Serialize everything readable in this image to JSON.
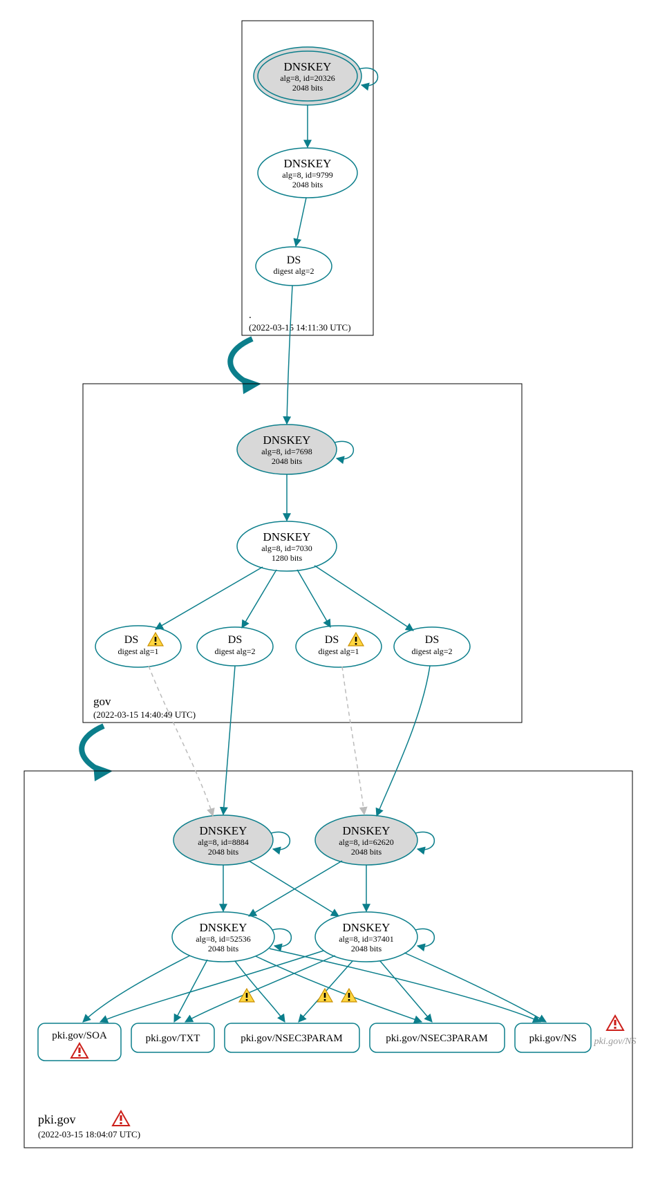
{
  "zones": {
    "root": {
      "name": ".",
      "timestamp": "(2022-03-15 14:11:30 UTC)"
    },
    "gov": {
      "name": "gov",
      "timestamp": "(2022-03-15 14:40:49 UTC)"
    },
    "pki": {
      "name": "pki.gov",
      "timestamp": "(2022-03-15 18:04:07 UTC)"
    }
  },
  "nodes": {
    "root_ksk": {
      "title": "DNSKEY",
      "l2": "alg=8, id=20326",
      "l3": "2048 bits"
    },
    "root_zsk": {
      "title": "DNSKEY",
      "l2": "alg=8, id=9799",
      "l3": "2048 bits"
    },
    "root_ds": {
      "title": "DS",
      "l2": "digest alg=2"
    },
    "gov_ksk": {
      "title": "DNSKEY",
      "l2": "alg=8, id=7698",
      "l3": "2048 bits"
    },
    "gov_zsk": {
      "title": "DNSKEY",
      "l2": "alg=8, id=7030",
      "l3": "1280 bits"
    },
    "gov_ds1": {
      "title": "DS",
      "l2": "digest alg=1"
    },
    "gov_ds2": {
      "title": "DS",
      "l2": "digest alg=2"
    },
    "gov_ds3": {
      "title": "DS",
      "l2": "digest alg=1"
    },
    "gov_ds4": {
      "title": "DS",
      "l2": "digest alg=2"
    },
    "pki_ksk1": {
      "title": "DNSKEY",
      "l2": "alg=8, id=8884",
      "l3": "2048 bits"
    },
    "pki_ksk2": {
      "title": "DNSKEY",
      "l2": "alg=8, id=62620",
      "l3": "2048 bits"
    },
    "pki_zsk1": {
      "title": "DNSKEY",
      "l2": "alg=8, id=52536",
      "l3": "2048 bits"
    },
    "pki_zsk2": {
      "title": "DNSKEY",
      "l2": "alg=8, id=37401",
      "l3": "2048 bits"
    },
    "rr_soa": {
      "label": "pki.gov/SOA"
    },
    "rr_txt": {
      "label": "pki.gov/TXT"
    },
    "rr_n3p1": {
      "label": "pki.gov/NSEC3PARAM"
    },
    "rr_n3p2": {
      "label": "pki.gov/NSEC3PARAM"
    },
    "rr_ns": {
      "label": "pki.gov/NS"
    },
    "rr_ns_ghost": {
      "label": "pki.gov/NS"
    }
  }
}
